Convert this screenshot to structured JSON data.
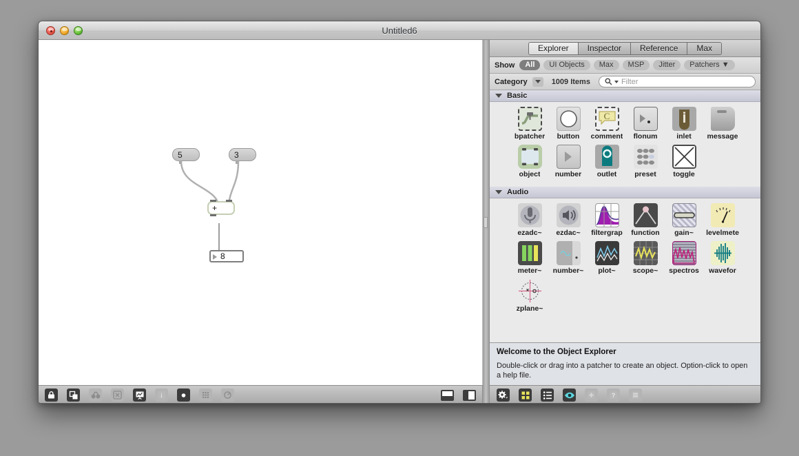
{
  "window": {
    "title": "Untitled6"
  },
  "traffic": {
    "close": "close-button",
    "minimize": "minimize-button",
    "zoom": "zoom-button"
  },
  "patcher": {
    "messages": [
      {
        "value": "5"
      },
      {
        "value": "3"
      }
    ],
    "object": {
      "text": "+"
    },
    "number": {
      "value": "8"
    }
  },
  "patcher_toolbar": [
    {
      "name": "lock-icon",
      "state": "on"
    },
    {
      "name": "presentation-mode-icon",
      "state": "on"
    },
    {
      "name": "binoculars-icon",
      "state": "off"
    },
    {
      "name": "close-x-icon",
      "state": "off"
    },
    {
      "name": "chart-icon",
      "state": "on"
    },
    {
      "name": "info-icon",
      "state": "off"
    },
    {
      "name": "sphere-icon",
      "state": "on"
    },
    {
      "name": "grid-icon",
      "state": "off"
    },
    {
      "name": "dial-icon",
      "state": "off"
    }
  ],
  "panel_buttons": [
    {
      "name": "split-horizontal-icon"
    },
    {
      "name": "split-vertical-icon"
    }
  ],
  "sidebar": {
    "tabs": [
      {
        "label": "Explorer",
        "active": true
      },
      {
        "label": "Inspector",
        "active": false
      },
      {
        "label": "Reference",
        "active": false
      },
      {
        "label": "Max",
        "active": false
      }
    ],
    "show": {
      "label": "Show",
      "filters": [
        {
          "label": "All",
          "selected": true
        },
        {
          "label": "UI Objects",
          "selected": false
        },
        {
          "label": "Max",
          "selected": false
        },
        {
          "label": "MSP",
          "selected": false
        },
        {
          "label": "Jitter",
          "selected": false
        },
        {
          "label": "Patchers ▼",
          "selected": false
        }
      ]
    },
    "category": {
      "label": "Category",
      "count": "1009 Items",
      "filter_placeholder": "Filter"
    },
    "sections": [
      {
        "title": "Basic",
        "items": [
          {
            "label": "bpatcher",
            "icon": "bpatcher-icon"
          },
          {
            "label": "button",
            "icon": "button-icon"
          },
          {
            "label": "comment",
            "icon": "comment-icon"
          },
          {
            "label": "flonum",
            "icon": "flonum-icon"
          },
          {
            "label": "inlet",
            "icon": "inlet-icon"
          },
          {
            "label": "message",
            "icon": "message-icon"
          },
          {
            "label": "object",
            "icon": "object-icon"
          },
          {
            "label": "number",
            "icon": "number-icon"
          },
          {
            "label": "outlet",
            "icon": "outlet-icon"
          },
          {
            "label": "preset",
            "icon": "preset-icon"
          },
          {
            "label": "toggle",
            "icon": "toggle-icon"
          }
        ]
      },
      {
        "title": "Audio",
        "items": [
          {
            "label": "ezadc~",
            "icon": "ezadc-icon"
          },
          {
            "label": "ezdac~",
            "icon": "ezdac-icon"
          },
          {
            "label": "filtergrap",
            "icon": "filtergraph-icon"
          },
          {
            "label": "function",
            "icon": "function-icon"
          },
          {
            "label": "gain~",
            "icon": "gain-icon"
          },
          {
            "label": "levelmete",
            "icon": "levelmeter-icon"
          },
          {
            "label": "meter~",
            "icon": "meter-icon"
          },
          {
            "label": "number~",
            "icon": "number-tilde-icon"
          },
          {
            "label": "plot~",
            "icon": "plot-icon"
          },
          {
            "label": "scope~",
            "icon": "scope-icon"
          },
          {
            "label": "spectros",
            "icon": "spectroscope-icon"
          },
          {
            "label": "wavefor",
            "icon": "waveform-icon"
          },
          {
            "label": "zplane~",
            "icon": "zplane-icon"
          }
        ]
      }
    ],
    "info": {
      "heading": "Welcome to the Object Explorer",
      "body": "Double-click or drag into a patcher to create an object. Option-click to open a help file."
    },
    "bottom_toolbar": [
      {
        "name": "gear-icon",
        "state": "on"
      },
      {
        "name": "grid-view-icon",
        "state": "on"
      },
      {
        "name": "list-view-icon",
        "state": "on"
      },
      {
        "name": "eye-icon",
        "state": "on"
      },
      {
        "name": "plus-icon",
        "state": "off"
      },
      {
        "name": "help-icon",
        "state": "off"
      },
      {
        "name": "menu-icon",
        "state": "off"
      }
    ]
  },
  "colors": {
    "accent_green": "#c4cfb4",
    "eye_cyan": "#5fd8e0",
    "grid_yellow": "#e8e35a",
    "object_teal": "#0c7b7f"
  }
}
